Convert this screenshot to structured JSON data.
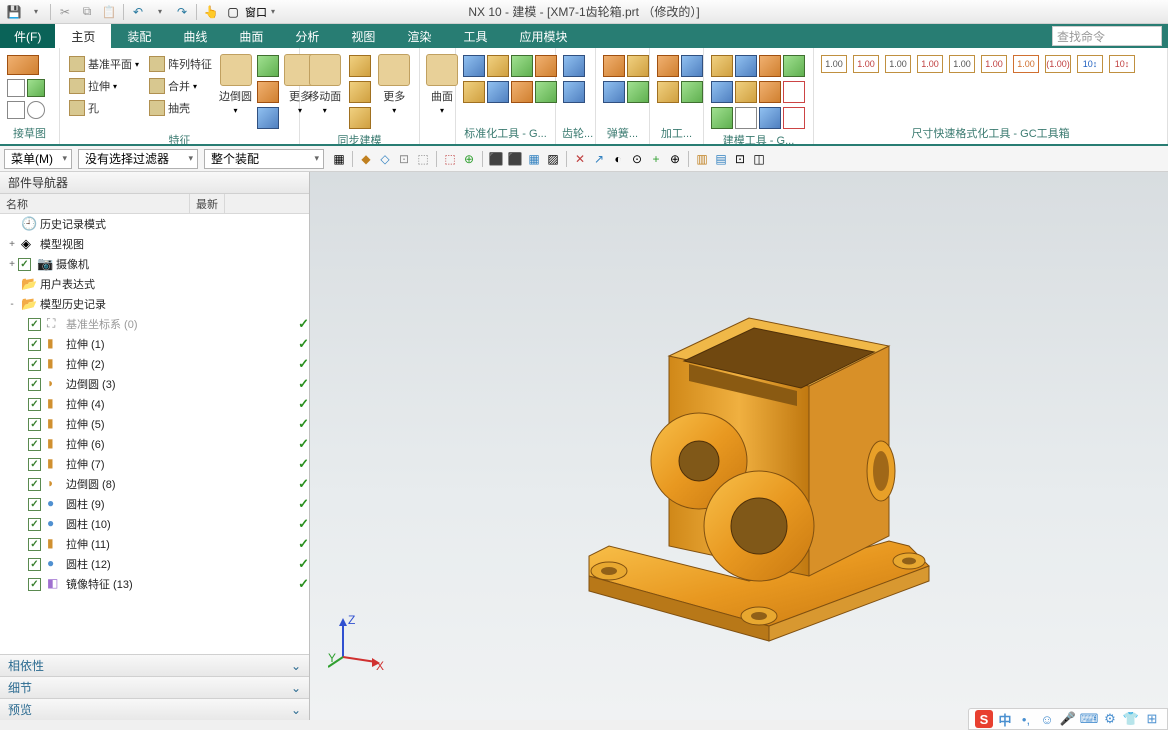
{
  "title": "NX 10 - 建模 - [XM7-1齿轮箱.prt （修改的）]",
  "qat": {
    "window_label": "窗口"
  },
  "menu": {
    "file": "件(F)",
    "tabs": [
      "主页",
      "装配",
      "曲线",
      "曲面",
      "分析",
      "视图",
      "渲染",
      "工具",
      "应用模块"
    ],
    "search_ph": "查找命令"
  },
  "ribbon": {
    "groups": [
      {
        "cap": "接草图"
      },
      {
        "cap": "特征",
        "items": [
          "基准平面",
          "拉伸",
          "孔",
          "阵列特征",
          "合并",
          "抽壳"
        ],
        "large": "边倒圆",
        "more": "更多"
      },
      {
        "cap": "同步建模",
        "large": "移动面",
        "more": "更多"
      },
      {
        "cap": "曲面"
      },
      {
        "cap": "标准化工具 - G..."
      },
      {
        "cap": "齿轮..."
      },
      {
        "cap": "弹簧..."
      },
      {
        "cap": "加工..."
      },
      {
        "cap": "建模工具 - G..."
      },
      {
        "cap": "尺寸快速格式化工具 - GC工具箱"
      }
    ]
  },
  "filter": {
    "menu": "菜单(M)",
    "no_filter": "没有选择过滤器",
    "assembly": "整个装配"
  },
  "nav": {
    "title": "部件导航器",
    "cols": {
      "name": "名称",
      "latest": "最新"
    },
    "root": [
      {
        "exp": "",
        "ic": "clock",
        "lbl": "历史记录模式"
      },
      {
        "exp": "+",
        "ic": "cube-g",
        "lbl": "模型视图"
      },
      {
        "exp": "+",
        "ic": "cam",
        "lbl": "摄像机",
        "chk": true
      },
      {
        "exp": "",
        "ic": "fold",
        "lbl": "用户表达式"
      },
      {
        "exp": "-",
        "ic": "fold",
        "lbl": "模型历史记录"
      }
    ],
    "hist": [
      {
        "lbl": "基准坐标系 (0)",
        "grey": true,
        "ic": "csys"
      },
      {
        "lbl": "拉伸 (1)",
        "ic": "ext"
      },
      {
        "lbl": "拉伸 (2)",
        "ic": "ext"
      },
      {
        "lbl": "边倒圆 (3)",
        "ic": "fil"
      },
      {
        "lbl": "拉伸 (4)",
        "ic": "ext"
      },
      {
        "lbl": "拉伸 (5)",
        "ic": "ext"
      },
      {
        "lbl": "拉伸 (6)",
        "ic": "ext"
      },
      {
        "lbl": "拉伸 (7)",
        "ic": "ext"
      },
      {
        "lbl": "边倒圆 (8)",
        "ic": "fil"
      },
      {
        "lbl": "圆柱 (9)",
        "ic": "cyl"
      },
      {
        "lbl": "圆柱 (10)",
        "ic": "cyl"
      },
      {
        "lbl": "拉伸 (11)",
        "ic": "ext"
      },
      {
        "lbl": "圆柱 (12)",
        "ic": "cyl"
      },
      {
        "lbl": "镜像特征 (13)",
        "ic": "mir"
      }
    ],
    "acc": [
      "相依性",
      "细节",
      "预览"
    ]
  },
  "dims": [
    "1.00",
    "1.00",
    "1.00",
    "1.00",
    "1.00",
    "1.00"
  ],
  "status": {
    "zh": "中"
  }
}
